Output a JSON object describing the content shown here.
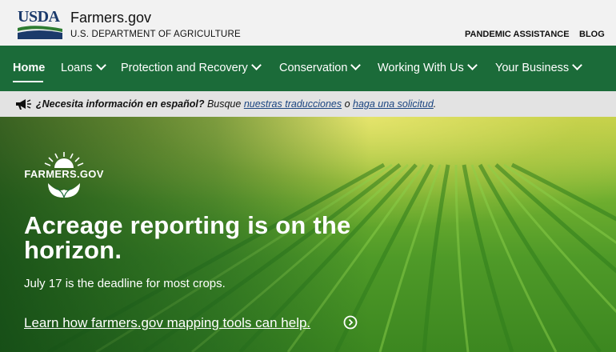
{
  "header": {
    "agency_logo_text": "USDA",
    "site_name": "Farmers.gov",
    "department": "U.S. DEPARTMENT OF AGRICULTURE",
    "utility_links": [
      "PANDEMIC ASSISTANCE",
      "BLOG"
    ]
  },
  "nav": {
    "items": [
      {
        "label": "Home",
        "active": true,
        "has_dropdown": false
      },
      {
        "label": "Loans",
        "active": false,
        "has_dropdown": true
      },
      {
        "label": "Protection and Recovery",
        "active": false,
        "has_dropdown": true
      },
      {
        "label": "Conservation",
        "active": false,
        "has_dropdown": true
      },
      {
        "label": "Working With Us",
        "active": false,
        "has_dropdown": true
      },
      {
        "label": "Your Business",
        "active": false,
        "has_dropdown": true
      }
    ]
  },
  "banner": {
    "icon": "megaphone-icon",
    "question": "¿Necesita información en español?",
    "text_1": " Busque ",
    "link_1": "nuestras traducciones",
    "text_2": " o ",
    "link_2": "haga una solicitud",
    "text_3": "."
  },
  "hero": {
    "logo_text": "FARMERS.GOV",
    "title": "Acreage reporting is on the horizon.",
    "subtitle": "July 17 is the deadline for most crops.",
    "link": "Learn how farmers.gov mapping tools can help.",
    "link_icon": "chevron-right-circle-icon"
  },
  "colors": {
    "nav_bg": "#1b6b39",
    "header_bg": "#f2f2f2",
    "banner_bg": "#e3e3e3",
    "usda_blue": "#1b3a6b",
    "usda_green": "#2e7d32"
  }
}
